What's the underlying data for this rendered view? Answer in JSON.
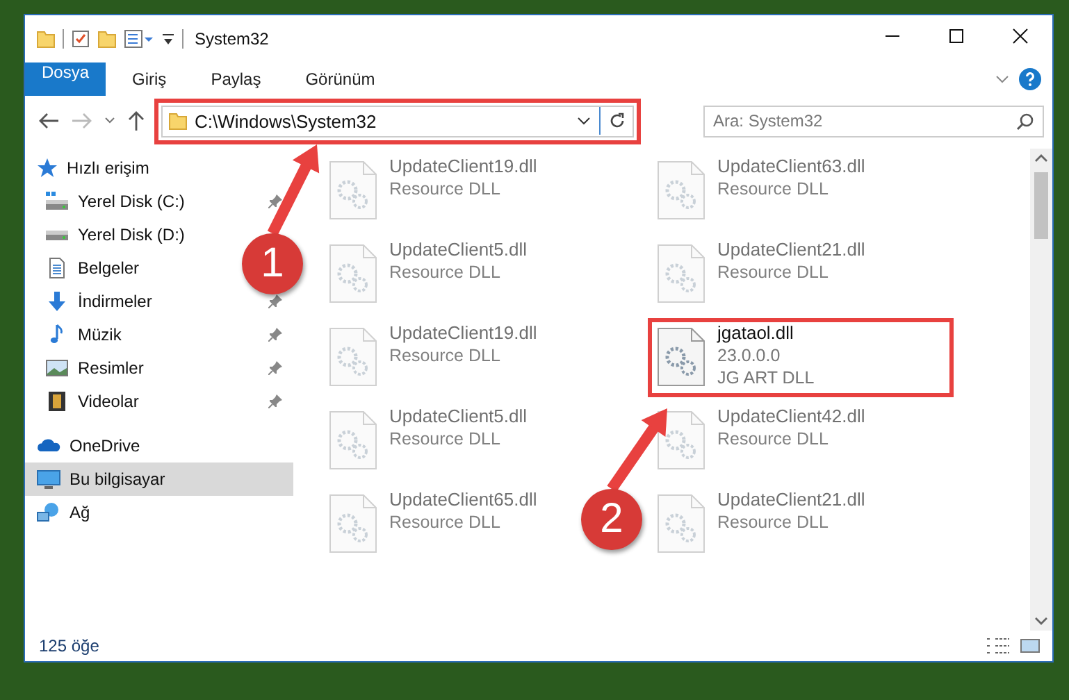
{
  "window": {
    "title": "System32"
  },
  "ribbon": {
    "tabs": [
      {
        "label": "Dosya",
        "kind": "file",
        "selected": false
      },
      {
        "label": "Giriş",
        "kind": "tab",
        "selected": false
      },
      {
        "label": "Paylaş",
        "kind": "tab",
        "selected": false
      },
      {
        "label": "Görünüm",
        "kind": "tab",
        "selected": false
      }
    ]
  },
  "address_bar": {
    "path": "C:\\Windows\\System32",
    "highlighted": true
  },
  "search": {
    "placeholder": "Ara: System32"
  },
  "sidebar": {
    "items": [
      {
        "label": "Hızlı erişim",
        "selected": false,
        "children": [
          {
            "label": "Yerel Disk (C:)",
            "pinned": true,
            "selected": false
          },
          {
            "label": "Yerel Disk (D:)",
            "pinned": false,
            "selected": false
          },
          {
            "label": "Belgeler",
            "pinned": false,
            "selected": false
          },
          {
            "label": "İndirmeler",
            "pinned": true,
            "selected": false
          },
          {
            "label": "Müzik",
            "pinned": true,
            "selected": false
          },
          {
            "label": "Resimler",
            "pinned": true,
            "selected": false
          },
          {
            "label": "Videolar",
            "pinned": true,
            "selected": false
          }
        ]
      },
      {
        "label": "OneDrive",
        "selected": false
      },
      {
        "label": "Bu bilgisayar",
        "selected": true
      },
      {
        "label": "Ağ",
        "selected": false
      }
    ]
  },
  "files": [
    {
      "name": "UpdateClient19.dll",
      "lines": [
        "Resource DLL"
      ],
      "blurred": true,
      "highlighted": false
    },
    {
      "name": "UpdateClient63.dll",
      "lines": [
        "Resource DLL"
      ],
      "blurred": true,
      "highlighted": false
    },
    {
      "name": "UpdateClient5.dll",
      "lines": [
        "Resource DLL"
      ],
      "blurred": true,
      "highlighted": false
    },
    {
      "name": "UpdateClient21.dll",
      "lines": [
        "Resource DLL"
      ],
      "blurred": true,
      "highlighted": false
    },
    {
      "name": "UpdateClient19.dll",
      "lines": [
        "Resource DLL"
      ],
      "blurred": true,
      "highlighted": false
    },
    {
      "name": "jgataol.dll",
      "lines": [
        "23.0.0.0",
        "JG ART DLL"
      ],
      "blurred": false,
      "highlighted": true
    },
    {
      "name": "UpdateClient5.dll",
      "lines": [
        "Resource DLL"
      ],
      "blurred": true,
      "highlighted": false
    },
    {
      "name": "UpdateClient42.dll",
      "lines": [
        "Resource DLL"
      ],
      "blurred": true,
      "highlighted": false
    },
    {
      "name": "UpdateClient65.dll",
      "lines": [
        "Resource DLL"
      ],
      "blurred": true,
      "highlighted": false
    },
    {
      "name": "UpdateClient21.dll",
      "lines": [
        "Resource DLL"
      ],
      "blurred": true,
      "highlighted": false
    }
  ],
  "status_bar": {
    "count": "125 öğe"
  },
  "annotations": [
    {
      "label": "1"
    },
    {
      "label": "2"
    }
  ]
}
